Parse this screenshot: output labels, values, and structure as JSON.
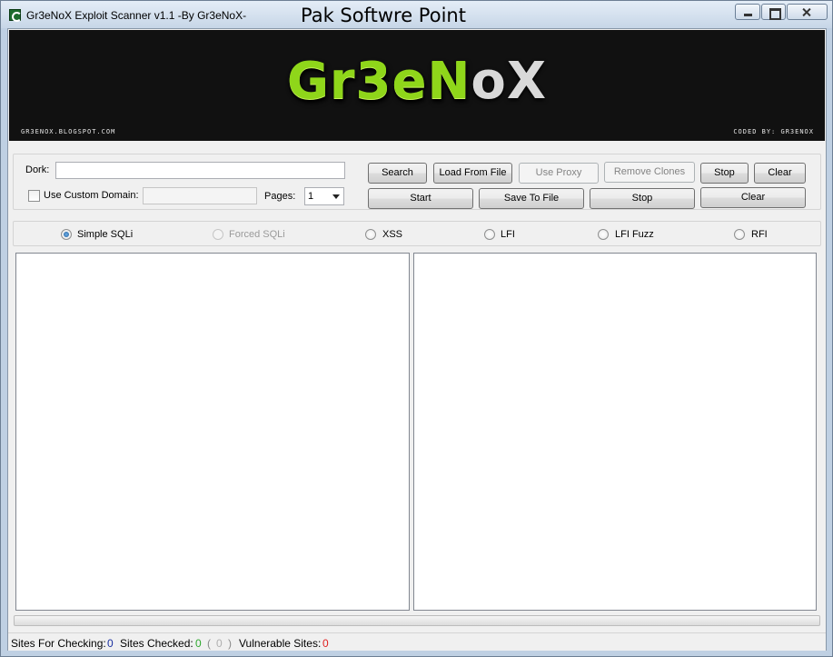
{
  "window": {
    "title": "Gr3eNoX Exploit Scanner v1.1 -By Gr3eNoX-",
    "overlay_text": "Pak Softwre Point"
  },
  "banner": {
    "logo_main": "Gr3eN",
    "logo_tail": "oX",
    "url": "GR3ENOX.BLOGSPOT.COM",
    "credit": "CODED BY: GR3ENOX"
  },
  "search": {
    "dork_label": "Dork:",
    "dork_value": "",
    "custom_domain_label": "Use Custom Domain:",
    "custom_domain_checked": false,
    "custom_domain_value": "",
    "pages_label": "Pages:",
    "pages_value": "1"
  },
  "buttons": {
    "search": "Search",
    "load_from_file": "Load From File",
    "use_proxy": "Use Proxy",
    "remove_clones": "Remove Clones",
    "stop_top": "Stop",
    "clear_top": "Clear",
    "start": "Start",
    "save_to_file": "Save To File",
    "stop_bottom": "Stop",
    "clear_bottom": "Clear"
  },
  "scan_modes": {
    "selected": "Simple SQLi",
    "options": [
      "Simple SQLi",
      "Forced SQLi",
      "XSS",
      "LFI",
      "LFI Fuzz",
      "RFI"
    ],
    "disabled": [
      "Forced SQLi"
    ]
  },
  "progress": {
    "value": 0
  },
  "status": {
    "sites_for_checking_label": "Sites For Checking:",
    "sites_for_checking": "0",
    "sites_checked_label": "Sites Checked:",
    "sites_checked": "0",
    "paren_open": "(",
    "sites_checked_sub": "0",
    "paren_close": ")",
    "vulnerable_label": "Vulnerable Sites:",
    "vulnerable": "0"
  },
  "colors": {
    "banner_bg": "#111111",
    "logo_green": "#8fd61a",
    "checked_count": "#2ea82e",
    "vulnerable_count": "#e02020",
    "for_checking_count": "#1a2fa0"
  }
}
